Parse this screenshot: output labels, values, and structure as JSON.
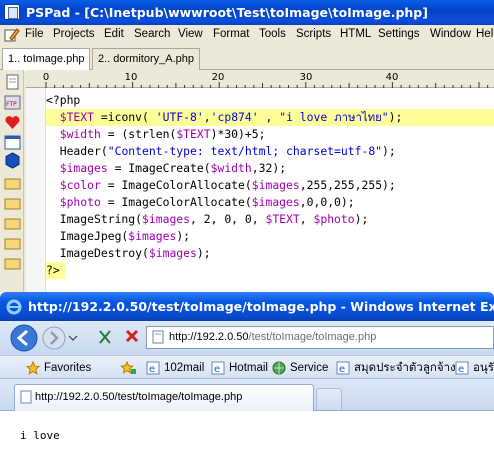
{
  "pspad": {
    "title": "PSPad - [C:\\Inetpub\\wwwroot\\Test\\toImage\\toImage.php]",
    "menu": [
      "File",
      "Projects",
      "Edit",
      "Search",
      "View",
      "Format",
      "Tools",
      "Scripts",
      "HTML",
      "Settings",
      "Window",
      "Hel"
    ],
    "tabs": [
      "1.. toImage.php",
      "2.. dormitory_A.php"
    ],
    "ruler_labels": [
      "0",
      "10",
      "20",
      "30",
      "40"
    ],
    "code": {
      "l1": "<?php",
      "l2_a": "  $TEXT",
      "l2_b": " =iconv( ",
      "l2_c": "'UTF-8'",
      "l2_d": ",",
      "l2_e": "'cp874'",
      "l2_f": " , ",
      "l2_g": "\"i love ภาษาไทย\"",
      "l2_h": ");",
      "l3_a": "  $width",
      "l3_b": " = (strlen(",
      "l3_c": "$TEXT",
      "l3_d": ")*30)+5;",
      "l4_a": "  Header(",
      "l4_b": "\"Content-type: text/html; charset=utf-8\"",
      "l4_c": ");",
      "l5_a": "  $images",
      "l5_b": " = ImageCreate(",
      "l5_c": "$width",
      "l5_d": ",32);",
      "l6_a": "  $color",
      "l6_b": " = ImageColorAllocate(",
      "l6_c": "$images",
      "l6_d": ",255,255,255);",
      "l7_a": "  $photo",
      "l7_b": " = ImageColorAllocate(",
      "l7_c": "$images",
      "l7_d": ",0,0,0);",
      "l8_a": "  ImageString(",
      "l8_b": "$images",
      "l8_c": ", 2, 0, 0, ",
      "l8_d": "$TEXT",
      "l8_e": ", ",
      "l8_f": "$photo",
      "l8_g": ");",
      "l9_a": "  ImageJpeg(",
      "l9_b": "$images",
      "l9_c": ");",
      "l10_a": "  ImageDestroy(",
      "l10_b": "$images",
      "l10_c": ");",
      "l11": "?>"
    }
  },
  "ie": {
    "title": "http://192.2.0.50/test/toImage/toImage.php - Windows Internet Explorer",
    "address_host": "http://192.2.0.50",
    "address_path": "/test/toImage/toImage.php",
    "favorites_label": "Favorites",
    "links": [
      "102mail",
      "Hotmail",
      "Service",
      "สมุดประจำตัวลูกจ้าง",
      "อนุรั"
    ],
    "tab_label": "http://192.2.0.50/test/toImage/toImage.php",
    "page_output": "i love"
  },
  "colors": {
    "variable": "#a100b0",
    "string": "#0000d8",
    "highlight": "#ffff99",
    "xp_title_blue": "#0443c9"
  }
}
